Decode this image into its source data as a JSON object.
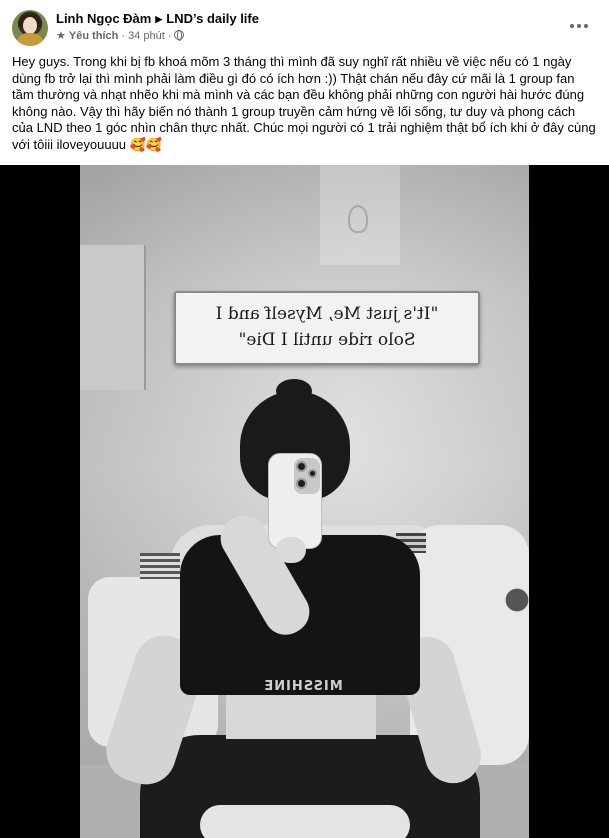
{
  "post": {
    "author": "Linh Ngọc Đàm",
    "group": "LND’s daily life",
    "badge": "Yêu thích",
    "timestamp": "34 phút",
    "separator": "·",
    "privacy_icon": "globe-icon",
    "caption": "Hey guys. Trong khi bị fb khoá mõm 3 tháng thì mình đã suy nghĩ rất nhiều về việc nếu có 1 ngày dùng fb trở lại thì mình phải làm điều gì đó có ích hơn :)) Thật chán nếu đây cứ mãi là 1 group fan tầm thường và nhạt nhẽo khi mà mình và các bạn đều không phải những con người hài hước đúng không nào. Vậy thì hãy biến nó thành 1 group truyền cảm hứng về lối sống, tư duy và phong cách của LND theo 1 góc nhìn chân thực nhất. Chúc mọi người có 1 trải nghiệm thật bổ ích khi ở đây cùng với tôiii iloveyouuuu",
    "emoji": "🥰🥰"
  },
  "photo": {
    "sign_line_1": "\"It's just Me, Myself and I",
    "sign_line_2": "Solo ride until I Die\"",
    "shirt_text": "MISSHINE"
  },
  "icons": {
    "more": "more-horizontal-icon",
    "badge": "star-icon",
    "triangle": "triangle-right-icon"
  },
  "colors": {
    "text": "#050505",
    "secondary": "#65676b",
    "background": "#ffffff"
  }
}
